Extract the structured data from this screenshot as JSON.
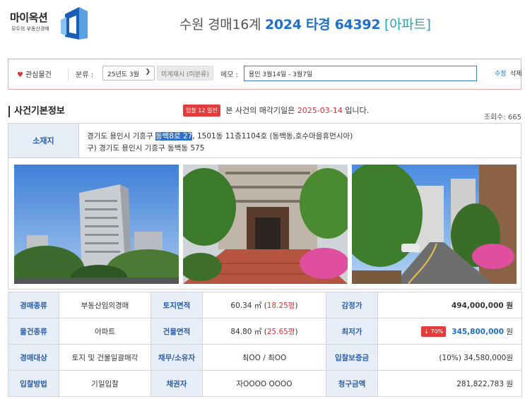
{
  "logo": {
    "name": "마이옥션",
    "tagline": "모두의 부동산경매"
  },
  "header": {
    "court": "수원 경매16계",
    "case_no": "2024 타경 64392",
    "property_type": "[아파트]"
  },
  "toolbar": {
    "favorite_label": "관심물건",
    "category_label": "분류 :",
    "category_value": "25년도 3월",
    "uncategorized_label": "미게재시 (미분류)",
    "memo_label": "메모 :",
    "memo_value": "용인 3월14일 - 3월7일",
    "edit_label": "수정",
    "delete_label": "삭제"
  },
  "section": {
    "title": "사건기본정보",
    "days_badge": "입찰 12 일전",
    "notice_prefix": "본 사건의 매각기일은",
    "sale_date": "2025-03-14",
    "notice_suffix": "입니다.",
    "views": "조회수: 665"
  },
  "location": {
    "label": "소재지",
    "line1_pre": "경기도 용인시 기흥구",
    "line1_highlight": "동백8로 27",
    "line1_post": ", 1501동 11층1104호 (동백동,호수마을휴먼시아)",
    "line2": "구) 경기도 용인시 기흥구 동백동 575"
  },
  "info": {
    "auction_type": {
      "label": "경매종류",
      "value": "부동산임의경매"
    },
    "land_area": {
      "label": "토지면적",
      "sqm": "60.34 ㎡ (",
      "pyeong": "18.25평",
      "close": ")"
    },
    "appraisal": {
      "label": "감정가",
      "value": "494,000,000 원"
    },
    "item_type": {
      "label": "물건종류",
      "value": "아파트"
    },
    "building_area": {
      "label": "건물면적",
      "sqm": "84.80 ㎡ (",
      "pyeong": "25.65평",
      "close": ")"
    },
    "min_price": {
      "label": "최저가",
      "rate": "↓ 70%",
      "value": "345,800,000",
      "unit": " 원"
    },
    "target": {
      "label": "경매대상",
      "value": "토지 및 건물일괄매각"
    },
    "owner": {
      "label": "채무/소유자",
      "value": "최OO / 최OO"
    },
    "deposit": {
      "label": "입찰보증금",
      "value": "(10%) 34,580,000원"
    },
    "bid_method": {
      "label": "입찰방법",
      "value": "기일입찰"
    },
    "creditor": {
      "label": "채권자",
      "value": "자OOOO OOOO"
    },
    "claim": {
      "label": "청구금액",
      "value": "281,822,783 원"
    }
  },
  "colors": {
    "accent_blue": "#1e6fc8",
    "alert_red": "#d33",
    "label_bg": "#e7eef8"
  }
}
